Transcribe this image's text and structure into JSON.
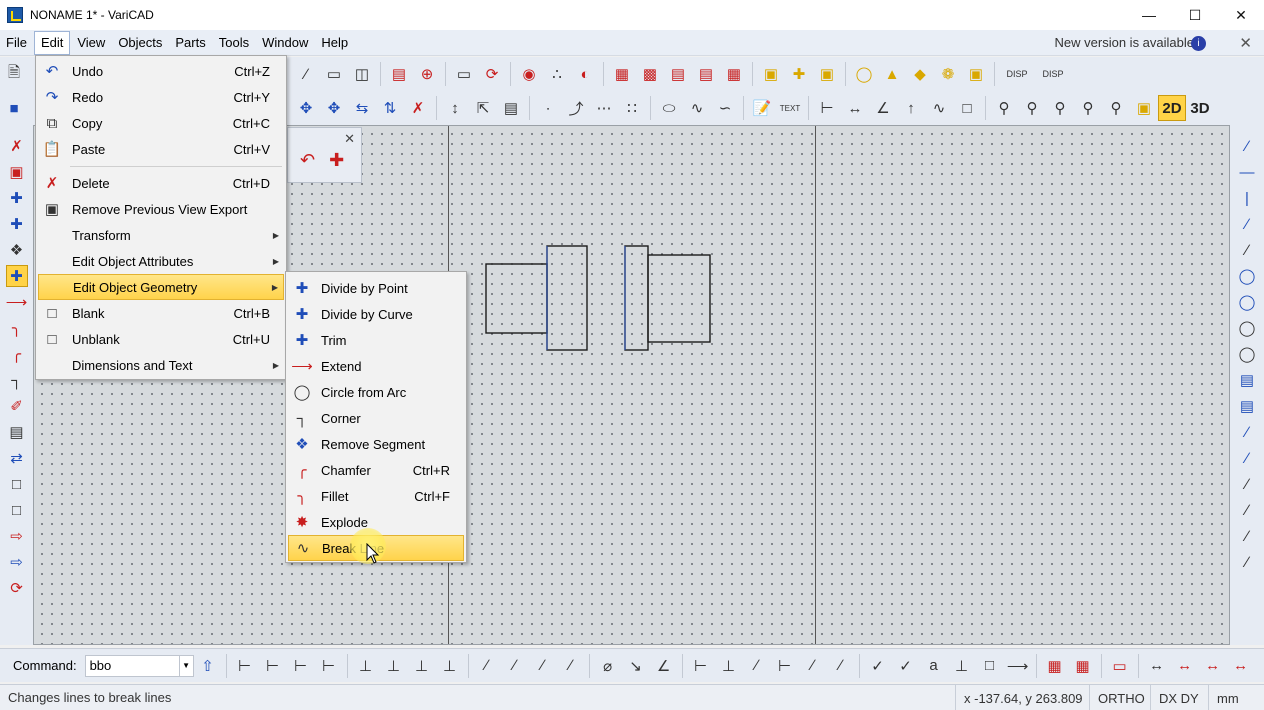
{
  "window": {
    "title": "NONAME 1* - VariCAD"
  },
  "menubar": {
    "items": [
      "File",
      "Edit",
      "View",
      "Objects",
      "Parts",
      "Tools",
      "Window",
      "Help"
    ],
    "new_version": "New version is available"
  },
  "edit_menu": {
    "items": [
      {
        "label": "Undo",
        "shortcut": "Ctrl+Z",
        "icon": "undo-icon"
      },
      {
        "label": "Redo",
        "shortcut": "Ctrl+Y",
        "icon": "redo-icon"
      },
      {
        "label": "Copy",
        "shortcut": "Ctrl+C",
        "icon": "copy-icon"
      },
      {
        "label": "Paste",
        "shortcut": "Ctrl+V",
        "icon": "paste-icon"
      },
      {
        "label": "Delete",
        "shortcut": "Ctrl+D",
        "icon": "delete-icon"
      },
      {
        "label": "Remove Previous View Export",
        "shortcut": "",
        "icon": "remove-export-icon"
      },
      {
        "label": "Transform",
        "shortcut": "",
        "icon": ""
      },
      {
        "label": "Edit Object Attributes",
        "shortcut": "",
        "icon": ""
      },
      {
        "label": "Edit Object Geometry",
        "shortcut": "",
        "icon": ""
      },
      {
        "label": "Blank",
        "shortcut": "Ctrl+B",
        "icon": "blank-icon"
      },
      {
        "label": "Unblank",
        "shortcut": "Ctrl+U",
        "icon": "unblank-icon"
      },
      {
        "label": "Dimensions and Text",
        "shortcut": "",
        "icon": ""
      }
    ]
  },
  "geometry_submenu": {
    "items": [
      {
        "label": "Divide by Point",
        "shortcut": ""
      },
      {
        "label": "Divide by Curve",
        "shortcut": ""
      },
      {
        "label": "Trim",
        "shortcut": ""
      },
      {
        "label": "Extend",
        "shortcut": ""
      },
      {
        "label": "Circle from Arc",
        "shortcut": ""
      },
      {
        "label": "Corner",
        "shortcut": ""
      },
      {
        "label": "Remove Segment",
        "shortcut": ""
      },
      {
        "label": "Chamfer",
        "shortcut": "Ctrl+R"
      },
      {
        "label": "Fillet",
        "shortcut": "Ctrl+F"
      },
      {
        "label": "Explode",
        "shortcut": ""
      },
      {
        "label": "Break Line",
        "shortcut": ""
      }
    ]
  },
  "toolbar": {
    "view_2d": "2D",
    "view_3d": "3D",
    "disp1": "DISP",
    "disp2": "DISP",
    "text_icon": "TEXT"
  },
  "command": {
    "label": "Command:",
    "value": "bbo"
  },
  "status": {
    "message": "Changes lines to break lines",
    "coords": "x -137.64, y 263.809",
    "ortho": "ORTHO",
    "dxdy": "DX DY",
    "units": "mm"
  }
}
